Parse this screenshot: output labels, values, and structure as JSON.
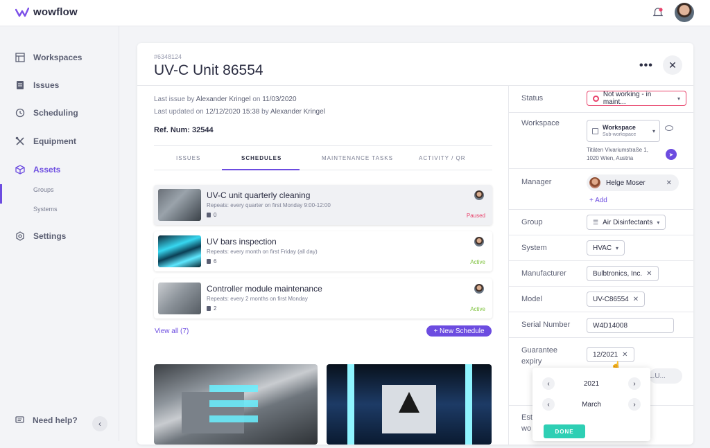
{
  "app": {
    "name": "wowflow"
  },
  "sidebar": {
    "items": [
      {
        "label": "Workspaces"
      },
      {
        "label": "Issues"
      },
      {
        "label": "Scheduling"
      },
      {
        "label": "Equipment"
      },
      {
        "label": "Assets"
      },
      {
        "label": "Settings"
      }
    ],
    "subitems": [
      {
        "label": "Groups"
      },
      {
        "label": "Systems"
      }
    ],
    "help": "Need help?",
    "collapse": "‹"
  },
  "asset": {
    "id": "#6348124",
    "title": "UV-C Unit 86554",
    "more": "•••",
    "close": "✕",
    "last_issue": {
      "prefix": "Last issue by",
      "user": "Alexander Kringel",
      "on": "on",
      "date": "11/03/2020"
    },
    "last_updated": {
      "prefix": "Last updated on",
      "date": "12/12/2020 15:38",
      "by": "by",
      "user": "Alexander Kringel"
    },
    "ref_num": "Ref. Num: 32544"
  },
  "tabs": [
    {
      "label": "ISSUES"
    },
    {
      "label": "SCHEDULES"
    },
    {
      "label": "MAINTENANCE TASKS"
    },
    {
      "label": "ACTIVITY / QR"
    }
  ],
  "schedules": [
    {
      "title": "UV-C unit quarterly cleaning",
      "repeat": "Repeats: every quarter on first Monday 9:00-12:00",
      "count": "0",
      "status": "Paused",
      "status_color": "#e8426b"
    },
    {
      "title": "UV bars inspection",
      "repeat": "Repeats: every month on first Friday (all day)",
      "count": "6",
      "status": "Active",
      "status_color": "#7cc13a"
    },
    {
      "title": "Controller module maintenance",
      "repeat": "Repeats: every 2 months on first Monday",
      "count": "2",
      "status": "Active",
      "status_color": "#7cc13a"
    }
  ],
  "view_all": "View all (7)",
  "new_schedule": "+ New Schedule",
  "fields": {
    "status": {
      "label": "Status",
      "value": "Not working - in maint..."
    },
    "workspace": {
      "label": "Workspace",
      "name": "Workspace",
      "sub": "Sub-workspace",
      "address1": "Titäten Vivariumstraße 1,",
      "address2": "1020 Wien, Austria"
    },
    "manager": {
      "label": "Manager",
      "name": "Helge Moser",
      "add": "+ Add"
    },
    "group": {
      "label": "Group",
      "value": "Air Disinfectants"
    },
    "system": {
      "label": "System",
      "value": "HVAC"
    },
    "manufacturer": {
      "label": "Manufacturer",
      "value": "Bulbtronics, Inc."
    },
    "model": {
      "label": "Model",
      "value": "UV-C86554"
    },
    "serial": {
      "label": "Serial Number",
      "value": "W4D14008"
    },
    "guarantee": {
      "label1": "Guarantee",
      "label2": "expiry",
      "value": "12/2021"
    },
    "partial_label": "Est",
    "partial_label2": "wo",
    "partial_tag": "L.U..."
  },
  "datepicker": {
    "year": "2021",
    "month": "March",
    "done": "DONE"
  },
  "colors": {
    "accent": "#6c4ce0",
    "paused": "#e8426b",
    "active": "#7cc13a",
    "done": "#2ecfb4"
  }
}
